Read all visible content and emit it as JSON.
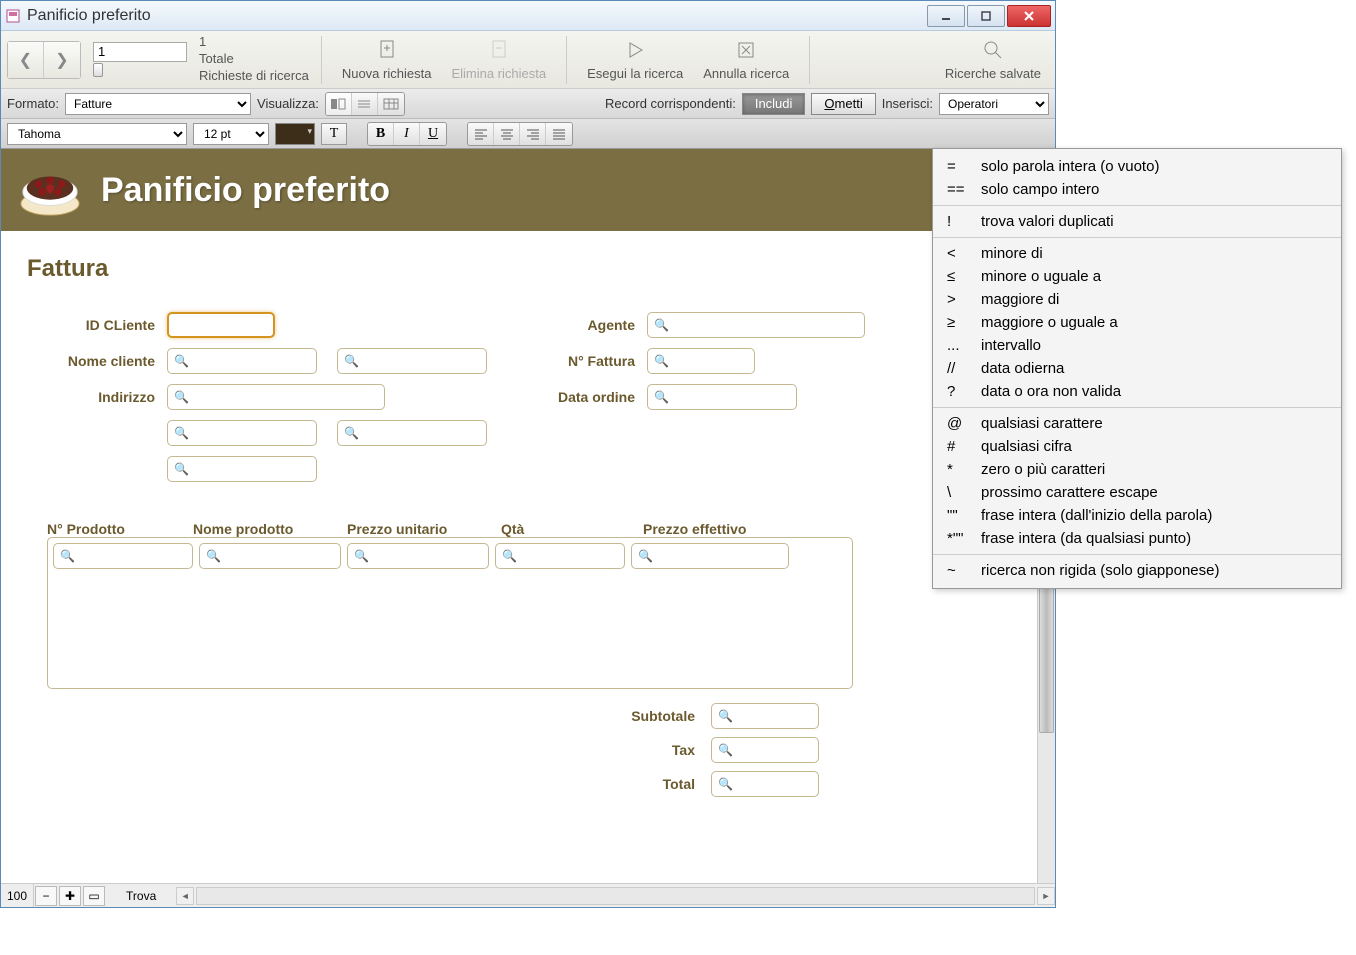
{
  "window": {
    "title": "Panificio preferito"
  },
  "toolbar1": {
    "record_value": "1",
    "total_count": "1",
    "total_label": "Totale",
    "requests_label": "Richieste di ricerca",
    "new_request": "Nuova richiesta",
    "delete_request": "Elimina richiesta",
    "run_search": "Esegui la ricerca",
    "cancel_search": "Annulla ricerca",
    "saved_searches": "Ricerche salvate"
  },
  "toolbar2": {
    "format_label": "Formato:",
    "format_value": "Fatture",
    "view_label": "Visualizza:",
    "matching_label": "Record corrispondenti:",
    "include": "Includi",
    "omit": "Ometti",
    "insert_label": "Inserisci:",
    "insert_value": "Operatori"
  },
  "toolbar3": {
    "font": "Tahoma",
    "size": "12 pt"
  },
  "header": {
    "app_title": "Panificio preferito"
  },
  "form": {
    "title": "Fattura",
    "labels": {
      "id_cliente": "ID CLiente",
      "nome_cliente": "Nome cliente",
      "indirizzo": "Indirizzo",
      "agente": "Agente",
      "n_fattura": "N° Fattura",
      "data_ordine": "Data ordine"
    },
    "product_headers": {
      "n_prodotto": "N° Prodotto",
      "nome_prodotto": "Nome prodotto",
      "prezzo_unitario": "Prezzo unitario",
      "qta": "Qtà",
      "prezzo_effettivo": "Prezzo effettivo"
    },
    "totals": {
      "subtotale": "Subtotale",
      "tax": "Tax",
      "total": "Total"
    }
  },
  "statusbar": {
    "zoom": "100",
    "mode": "Trova"
  },
  "operators_menu": [
    {
      "sym": "=",
      "txt": "solo parola intera (o vuoto)"
    },
    {
      "sym": "==",
      "txt": "solo campo intero"
    },
    {
      "sep": true
    },
    {
      "sym": "!",
      "txt": "trova valori duplicati"
    },
    {
      "sep": true
    },
    {
      "sym": "<",
      "txt": "minore di"
    },
    {
      "sym": "≤",
      "txt": "minore o uguale a"
    },
    {
      "sym": ">",
      "txt": "maggiore di"
    },
    {
      "sym": "≥",
      "txt": "maggiore o uguale a"
    },
    {
      "sym": "...",
      "txt": "intervallo"
    },
    {
      "sym": "//",
      "txt": "data odierna"
    },
    {
      "sym": "?",
      "txt": "data o ora non valida"
    },
    {
      "sep": true
    },
    {
      "sym": "@",
      "txt": "qualsiasi carattere"
    },
    {
      "sym": "#",
      "txt": "qualsiasi cifra"
    },
    {
      "sym": "*",
      "txt": "zero o più caratteri"
    },
    {
      "sym": "\\",
      "txt": "prossimo carattere escape"
    },
    {
      "sym": "\"\"",
      "txt": "frase intera (dall'inizio della parola)"
    },
    {
      "sym": "*\"\"",
      "txt": "frase intera (da qualsiasi punto)"
    },
    {
      "sep": true
    },
    {
      "sym": "~",
      "txt": "ricerca non rigida (solo giapponese)"
    }
  ]
}
